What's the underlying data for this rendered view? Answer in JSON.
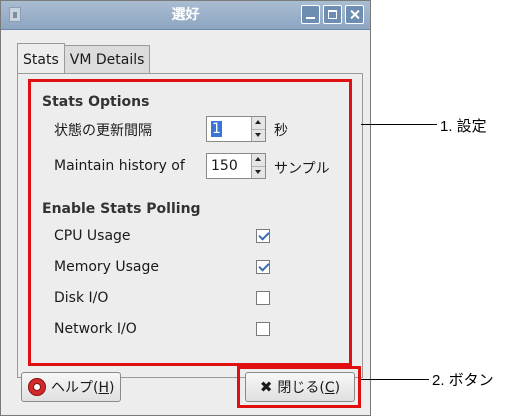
{
  "window": {
    "title": "選好"
  },
  "tabs": [
    {
      "label": "Stats",
      "active": true
    },
    {
      "label": "VM Details",
      "active": false
    }
  ],
  "stats_options": {
    "heading": "Stats Options",
    "update_interval": {
      "label": "状態の更新間隔",
      "value": "1",
      "unit": "秒"
    },
    "history": {
      "label": "Maintain history of",
      "value": "150",
      "unit": "サンプル"
    }
  },
  "polling": {
    "heading": "Enable Stats Polling",
    "items": [
      {
        "label": "CPU Usage",
        "checked": true
      },
      {
        "label": "Memory Usage",
        "checked": true
      },
      {
        "label": "Disk I/O",
        "checked": false
      },
      {
        "label": "Network I/O",
        "checked": false
      }
    ]
  },
  "buttons": {
    "help": {
      "text": "ヘルプ(",
      "mnemonic": "H",
      "close_paren": ")"
    },
    "close": {
      "text": "閉じる(",
      "mnemonic": "C",
      "close_paren": ")"
    }
  },
  "annotations": {
    "settings": "1. 設定",
    "buttons": "2. ボタン"
  },
  "colors": {
    "highlight_red": "#e01010",
    "titlebar": "#8ea6c2",
    "selection": "#3875d7"
  }
}
